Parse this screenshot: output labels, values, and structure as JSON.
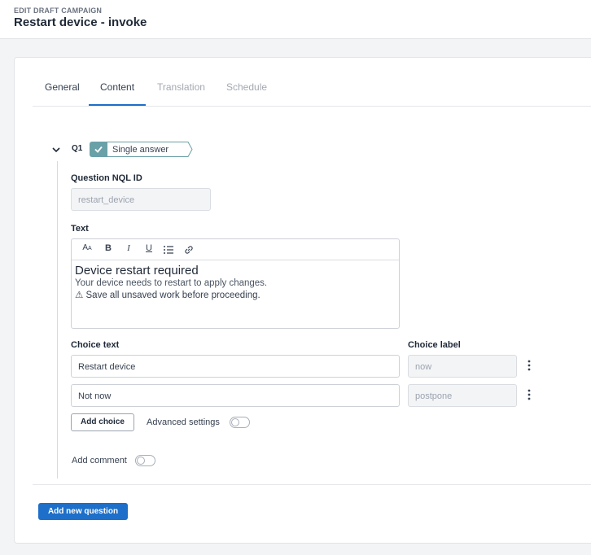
{
  "header": {
    "eyebrow": "EDIT DRAFT CAMPAIGN",
    "title": "Restart device - invoke"
  },
  "tabs": [
    {
      "label": "General",
      "state": "normal"
    },
    {
      "label": "Content",
      "state": "active"
    },
    {
      "label": "Translation",
      "state": "disabled"
    },
    {
      "label": "Schedule",
      "state": "disabled"
    }
  ],
  "question": {
    "number": "Q1",
    "type_badge": "Single answer",
    "nql_id_label": "Question NQL ID",
    "nql_id_placeholder": "restart_device",
    "text_label": "Text",
    "editor_toolbar": [
      "font-size-icon",
      "bold-icon",
      "italic-icon",
      "underline-icon",
      "bullet-list-icon",
      "link-icon"
    ],
    "editor": {
      "heading": "Device restart required",
      "paragraph": "Your device needs to restart to apply changes.",
      "warning": "Save all unsaved work before proceeding."
    },
    "choice_text_label": "Choice text",
    "choice_label_label": "Choice label",
    "choices": [
      {
        "text": "Restart device",
        "label_placeholder": "now"
      },
      {
        "text": "Not now",
        "label_placeholder": "postpone"
      }
    ],
    "add_choice": "Add choice",
    "advanced_settings": "Advanced settings",
    "add_comment": "Add comment"
  },
  "footer": {
    "add_new_question": "Add new question"
  },
  "colors": {
    "accent": "#1d6fc9",
    "badge": "#6aa0a8"
  }
}
